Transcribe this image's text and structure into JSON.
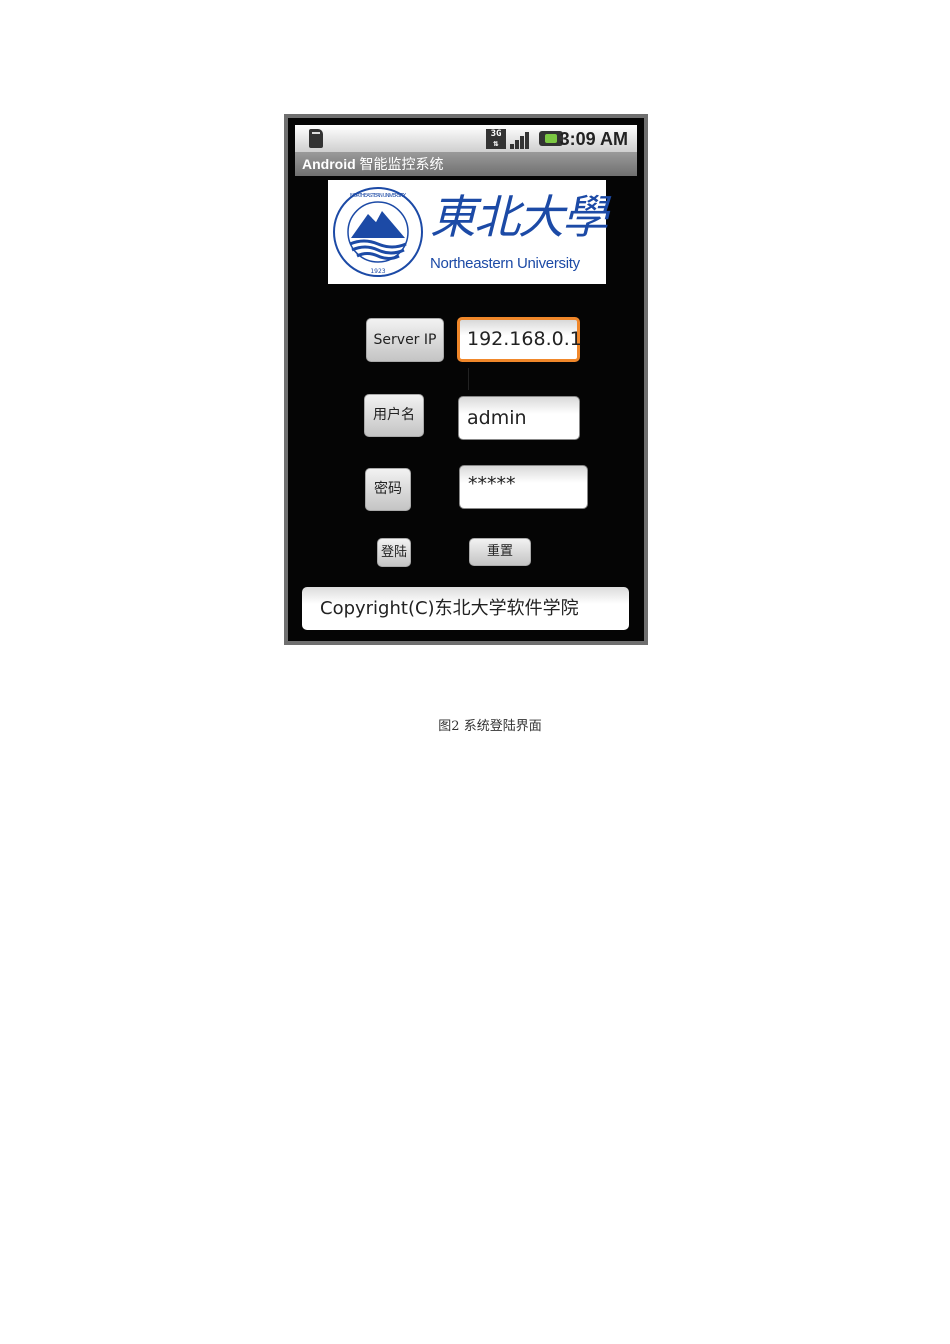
{
  "status_bar": {
    "time": "3:09 AM",
    "icons": [
      "sd-card-icon",
      "3g-data-icon",
      "signal-icon",
      "battery-icon"
    ],
    "network_label": "3G"
  },
  "app": {
    "title_brand": "Android",
    "title_rest": " 智能监控系统"
  },
  "logo": {
    "chinese": "東北大學",
    "english": "Northeastern University",
    "seal_year": "1923",
    "seal_ring_text": "NORTHEASTERN UNIVERSITY",
    "color": "#1c4aa6"
  },
  "form": {
    "server_ip_label": "Server IP",
    "server_ip_value": "192.168.0.1",
    "username_label": "用户名",
    "username_value": "admin",
    "password_label": "密码",
    "password_value": "*****",
    "login_button": "登陆",
    "reset_button": "重置",
    "focus_color": "#f0872a"
  },
  "footer": {
    "copyright": "Copyright(C)东北大学软件学院"
  },
  "caption": "图2  系统登陆界面"
}
